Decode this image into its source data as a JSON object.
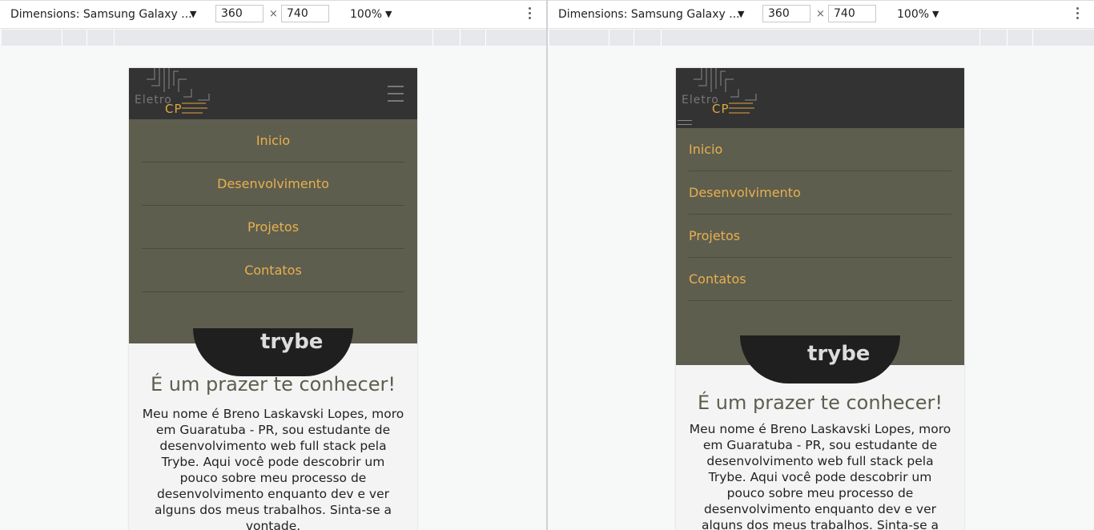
{
  "toolbar": {
    "device_label": "Dimensions: Samsung Galaxy ...",
    "width": "360",
    "height": "740",
    "times": "×",
    "zoom": "100%"
  },
  "site": {
    "logo_line1": "Eletro",
    "logo_line2": "CP",
    "menu": [
      "Inicio",
      "Desenvolvimento",
      "Projetos",
      "Contatos"
    ],
    "hero_text": "trybe",
    "title": "É um prazer te conhecer!",
    "bio": "Meu nome é Breno Laskavski Lopes, moro em Guaratuba - PR, sou estudante de desenvolvimento web full stack pela Trybe. Aqui você pode descobrir um pouco sobre meu processo de desenvolvimento enquanto dev e ver alguns dos meus trabalhos. Sinta-se a vontade."
  },
  "colors": {
    "header": "#333333",
    "menu_bg": "#5e5e4f",
    "accent": "#e8b04d",
    "title": "#5e5e4f"
  },
  "icons": [
    "dropdown-arrow-icon",
    "more-vert-icon",
    "hamburger-icon",
    "circuit-logo-icon"
  ]
}
